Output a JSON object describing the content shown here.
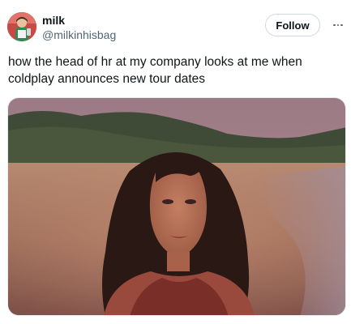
{
  "tweet": {
    "author": {
      "display_name": "milk",
      "handle": "@milkinhisbag",
      "avatar_icon": "avatar-photo"
    },
    "follow_label": "Follow",
    "more_icon": "more-horizontal-icon",
    "text": "how the head of hr at my company looks at me when coldplay announces new tour dates",
    "media": {
      "type": "photo",
      "description_icon": "media-photo"
    }
  },
  "colors": {
    "text_primary": "#0f1419",
    "text_secondary": "#536471",
    "border": "#cfd9de"
  }
}
